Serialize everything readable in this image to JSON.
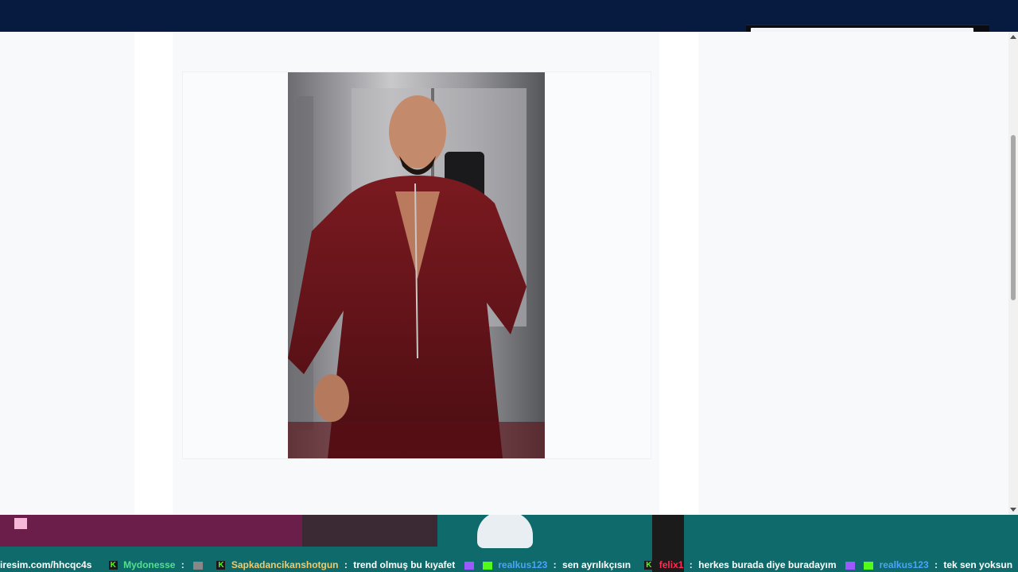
{
  "overlay": {
    "chat": [
      {
        "user": "",
        "text": "iresim.com/hhcqc4s",
        "user_color": "#ffffff"
      },
      {
        "user": "Mydonesse",
        "text": "",
        "user_color": "#53e08a"
      },
      {
        "user": "Sapkadancikanshotgun",
        "text": "trend olmuş bu kıyafet",
        "user_color": "#f3c96a"
      },
      {
        "user": "realkus123",
        "text": "sen ayrılıkçısın",
        "user_color": "#4aa3ff"
      },
      {
        "user": "felix1",
        "text": "herkes burada diye buradayım",
        "user_color": "#ff2d55"
      },
      {
        "user": "realkus123",
        "text": "tek sen yoksun",
        "user_color": "#4aa3ff"
      }
    ],
    "separator": ":"
  },
  "colors": {
    "topbar": "#071a3f",
    "page_bg": "#f7f9fb",
    "overlay_bg": "#0f6b6b"
  },
  "icons": {
    "kick_badge": "K"
  }
}
